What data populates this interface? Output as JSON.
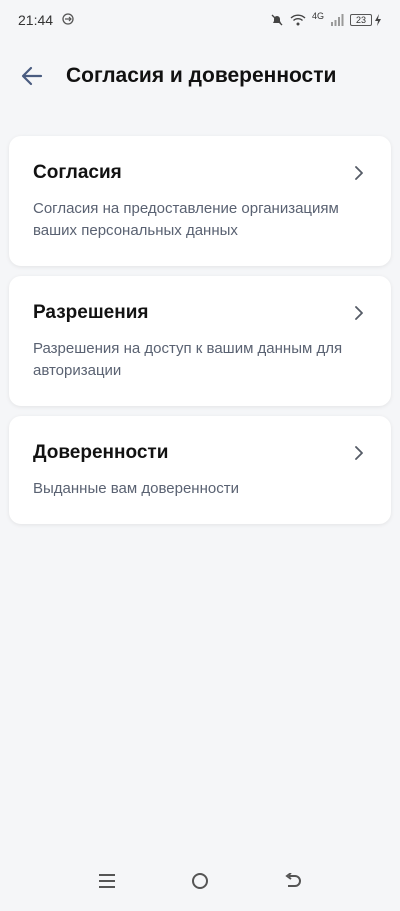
{
  "status_bar": {
    "time": "21:44",
    "network": "4G",
    "battery": "23"
  },
  "header": {
    "title": "Согласия и доверенности"
  },
  "cards": [
    {
      "title": "Согласия",
      "description": "Согласия на предоставление организациям ваших персональных данных"
    },
    {
      "title": "Разрешения",
      "description": "Разрешения на доступ к вашим данным для авторизации"
    },
    {
      "title": "Доверенности",
      "description": "Выданные вам доверенности"
    }
  ],
  "colors": {
    "background": "#f5f6f8",
    "card": "#ffffff",
    "title_text": "#111111",
    "description_text": "#5a6272",
    "chevron": "#555b66",
    "back_arrow": "#4a5c80"
  },
  "icons": {
    "back": "arrow-left-icon",
    "chevron": "chevron-right-icon",
    "nav_menu": "menu-icon",
    "nav_home": "home-circle-icon",
    "nav_back": "back-icon"
  }
}
